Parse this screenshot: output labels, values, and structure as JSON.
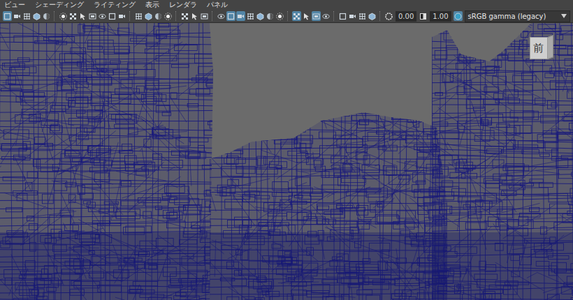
{
  "menu": [
    {
      "label": "ビュー"
    },
    {
      "label": "シェーディング"
    },
    {
      "label": "ライティング"
    },
    {
      "label": "表示"
    },
    {
      "label": "レンダラ"
    },
    {
      "label": "パネル"
    }
  ],
  "toolbar": {
    "groups": [
      [
        {
          "on": true
        },
        {
          "on": false
        },
        {
          "on": false
        },
        {
          "on": false
        },
        {
          "on": false
        }
      ],
      [
        {
          "on": false
        },
        {
          "on": false
        },
        {
          "on": false
        },
        {
          "on": false
        },
        {
          "on": false
        },
        {
          "on": false
        },
        {
          "on": false
        }
      ],
      [
        {
          "on": false
        },
        {
          "on": false
        },
        {
          "on": false
        },
        {
          "on": false
        }
      ],
      [
        {
          "on": false
        },
        {
          "on": false
        },
        {
          "on": false
        }
      ],
      [
        {
          "on": false
        },
        {
          "on": true
        },
        {
          "on": true
        },
        {
          "on": false
        },
        {
          "on": false
        },
        {
          "on": false
        },
        {
          "on": false
        }
      ],
      [
        {
          "on": true
        },
        {
          "on": false
        },
        {
          "on": true
        },
        {
          "on": false
        }
      ],
      [
        {
          "on": false
        },
        {
          "on": false
        },
        {
          "on": false
        },
        {
          "on": false
        }
      ]
    ],
    "exposure": "0.00",
    "gamma": "1.00",
    "colorspace": "sRGB gamma (legacy)"
  },
  "viewcube": {
    "label": "前"
  }
}
